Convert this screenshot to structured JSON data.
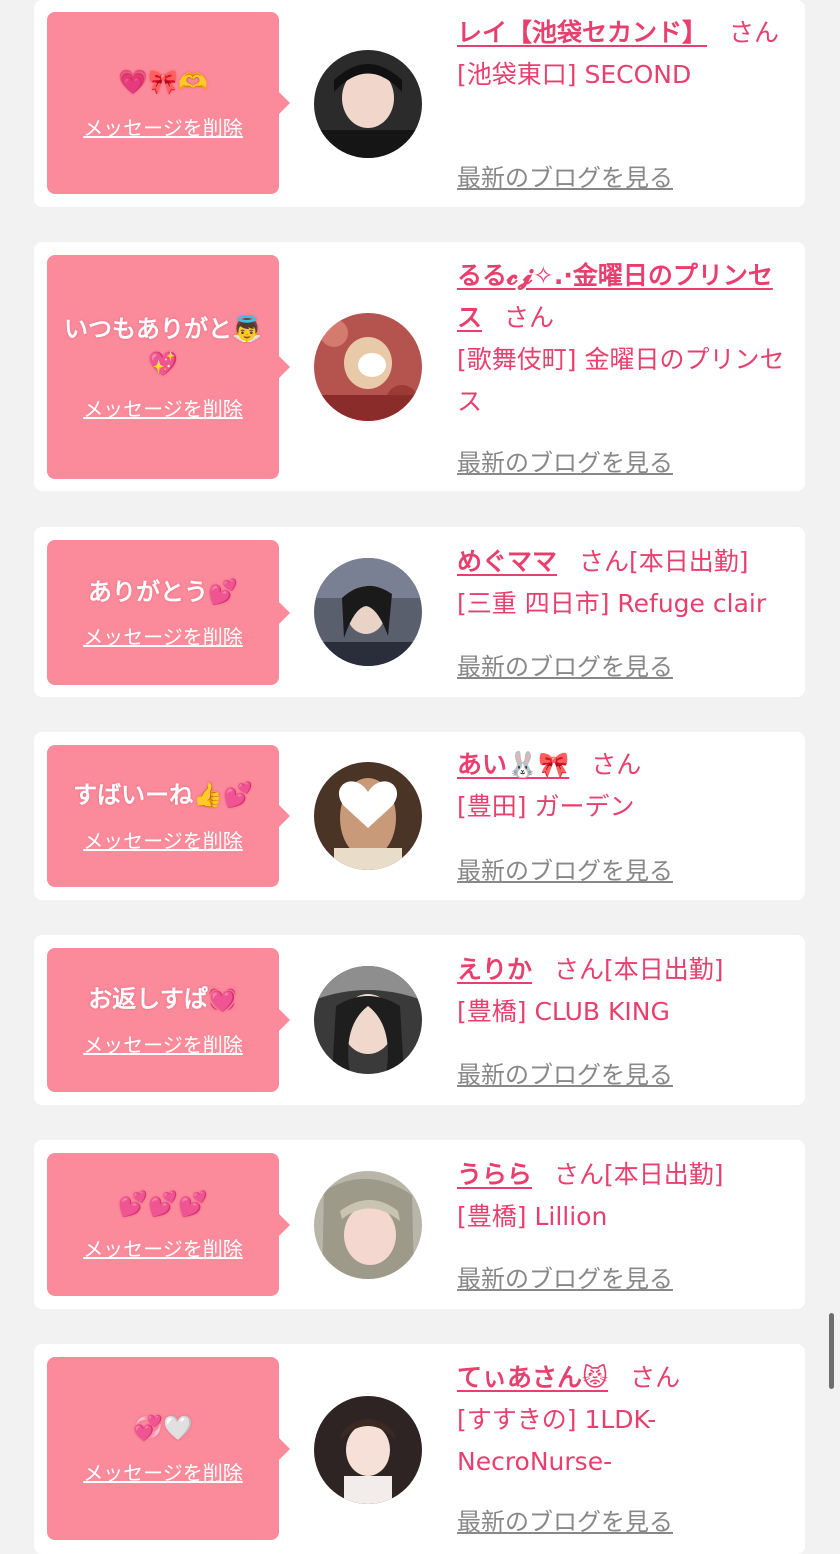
{
  "delete_label": "メッセージを削除",
  "blog_label": "最新のブログを見る",
  "san_suffix": "さん",
  "cards": [
    {
      "message": "💗🎀🫶",
      "name": "レイ【池袋セカンド】",
      "status": "",
      "area_shop": "[池袋東口] SECOND"
    },
    {
      "message": "いつもありがと👼💖",
      "name": "るる𝓬𝓳✧.·金曜日のプリンセス",
      "status": "",
      "area_shop": "[歌舞伎町] 金曜日のプリンセス"
    },
    {
      "message": "ありがとう💕",
      "name": "めぐママ",
      "status": "[本日出勤]",
      "area_shop": "[三重 四日市] Refuge clair"
    },
    {
      "message": "すばいーね👍💕",
      "name": "あい🐰🎀",
      "status": "",
      "area_shop": "[豊田] ガーデン"
    },
    {
      "message": "お返しすぱ💓",
      "name": "えりか",
      "status": "[本日出勤]",
      "area_shop": "[豊橋] CLUB KING"
    },
    {
      "message": "💕💕💕",
      "name": "うらら",
      "status": "[本日出勤]",
      "area_shop": "[豊橋] Lillion"
    },
    {
      "message": "💞🤍",
      "name": "てぃあさん😾",
      "status": "",
      "area_shop": "[すすきの] 1LDK-NecroNurse-"
    }
  ],
  "colors": {
    "page_bg": "#f2f2f2",
    "bubble_bg": "#fb8a9a",
    "accent": "#e8406e",
    "link_gray": "#888888"
  }
}
